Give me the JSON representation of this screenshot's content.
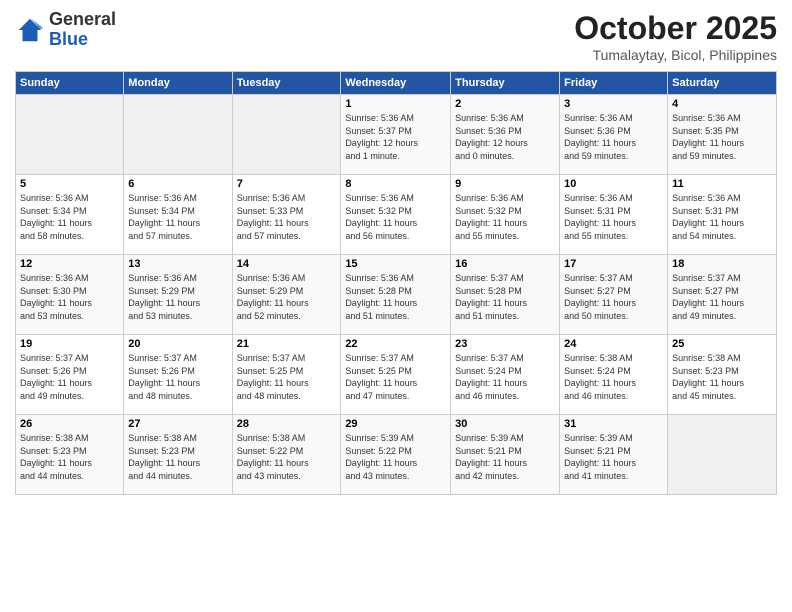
{
  "header": {
    "logo_general": "General",
    "logo_blue": "Blue",
    "month_title": "October 2025",
    "subtitle": "Tumalaytay, Bicol, Philippines"
  },
  "days_of_week": [
    "Sunday",
    "Monday",
    "Tuesday",
    "Wednesday",
    "Thursday",
    "Friday",
    "Saturday"
  ],
  "weeks": [
    [
      {
        "day": "",
        "info": ""
      },
      {
        "day": "",
        "info": ""
      },
      {
        "day": "",
        "info": ""
      },
      {
        "day": "1",
        "info": "Sunrise: 5:36 AM\nSunset: 5:37 PM\nDaylight: 12 hours\nand 1 minute."
      },
      {
        "day": "2",
        "info": "Sunrise: 5:36 AM\nSunset: 5:36 PM\nDaylight: 12 hours\nand 0 minutes."
      },
      {
        "day": "3",
        "info": "Sunrise: 5:36 AM\nSunset: 5:36 PM\nDaylight: 11 hours\nand 59 minutes."
      },
      {
        "day": "4",
        "info": "Sunrise: 5:36 AM\nSunset: 5:35 PM\nDaylight: 11 hours\nand 59 minutes."
      }
    ],
    [
      {
        "day": "5",
        "info": "Sunrise: 5:36 AM\nSunset: 5:34 PM\nDaylight: 11 hours\nand 58 minutes."
      },
      {
        "day": "6",
        "info": "Sunrise: 5:36 AM\nSunset: 5:34 PM\nDaylight: 11 hours\nand 57 minutes."
      },
      {
        "day": "7",
        "info": "Sunrise: 5:36 AM\nSunset: 5:33 PM\nDaylight: 11 hours\nand 57 minutes."
      },
      {
        "day": "8",
        "info": "Sunrise: 5:36 AM\nSunset: 5:32 PM\nDaylight: 11 hours\nand 56 minutes."
      },
      {
        "day": "9",
        "info": "Sunrise: 5:36 AM\nSunset: 5:32 PM\nDaylight: 11 hours\nand 55 minutes."
      },
      {
        "day": "10",
        "info": "Sunrise: 5:36 AM\nSunset: 5:31 PM\nDaylight: 11 hours\nand 55 minutes."
      },
      {
        "day": "11",
        "info": "Sunrise: 5:36 AM\nSunset: 5:31 PM\nDaylight: 11 hours\nand 54 minutes."
      }
    ],
    [
      {
        "day": "12",
        "info": "Sunrise: 5:36 AM\nSunset: 5:30 PM\nDaylight: 11 hours\nand 53 minutes."
      },
      {
        "day": "13",
        "info": "Sunrise: 5:36 AM\nSunset: 5:29 PM\nDaylight: 11 hours\nand 53 minutes."
      },
      {
        "day": "14",
        "info": "Sunrise: 5:36 AM\nSunset: 5:29 PM\nDaylight: 11 hours\nand 52 minutes."
      },
      {
        "day": "15",
        "info": "Sunrise: 5:36 AM\nSunset: 5:28 PM\nDaylight: 11 hours\nand 51 minutes."
      },
      {
        "day": "16",
        "info": "Sunrise: 5:37 AM\nSunset: 5:28 PM\nDaylight: 11 hours\nand 51 minutes."
      },
      {
        "day": "17",
        "info": "Sunrise: 5:37 AM\nSunset: 5:27 PM\nDaylight: 11 hours\nand 50 minutes."
      },
      {
        "day": "18",
        "info": "Sunrise: 5:37 AM\nSunset: 5:27 PM\nDaylight: 11 hours\nand 49 minutes."
      }
    ],
    [
      {
        "day": "19",
        "info": "Sunrise: 5:37 AM\nSunset: 5:26 PM\nDaylight: 11 hours\nand 49 minutes."
      },
      {
        "day": "20",
        "info": "Sunrise: 5:37 AM\nSunset: 5:26 PM\nDaylight: 11 hours\nand 48 minutes."
      },
      {
        "day": "21",
        "info": "Sunrise: 5:37 AM\nSunset: 5:25 PM\nDaylight: 11 hours\nand 48 minutes."
      },
      {
        "day": "22",
        "info": "Sunrise: 5:37 AM\nSunset: 5:25 PM\nDaylight: 11 hours\nand 47 minutes."
      },
      {
        "day": "23",
        "info": "Sunrise: 5:37 AM\nSunset: 5:24 PM\nDaylight: 11 hours\nand 46 minutes."
      },
      {
        "day": "24",
        "info": "Sunrise: 5:38 AM\nSunset: 5:24 PM\nDaylight: 11 hours\nand 46 minutes."
      },
      {
        "day": "25",
        "info": "Sunrise: 5:38 AM\nSunset: 5:23 PM\nDaylight: 11 hours\nand 45 minutes."
      }
    ],
    [
      {
        "day": "26",
        "info": "Sunrise: 5:38 AM\nSunset: 5:23 PM\nDaylight: 11 hours\nand 44 minutes."
      },
      {
        "day": "27",
        "info": "Sunrise: 5:38 AM\nSunset: 5:23 PM\nDaylight: 11 hours\nand 44 minutes."
      },
      {
        "day": "28",
        "info": "Sunrise: 5:38 AM\nSunset: 5:22 PM\nDaylight: 11 hours\nand 43 minutes."
      },
      {
        "day": "29",
        "info": "Sunrise: 5:39 AM\nSunset: 5:22 PM\nDaylight: 11 hours\nand 43 minutes."
      },
      {
        "day": "30",
        "info": "Sunrise: 5:39 AM\nSunset: 5:21 PM\nDaylight: 11 hours\nand 42 minutes."
      },
      {
        "day": "31",
        "info": "Sunrise: 5:39 AM\nSunset: 5:21 PM\nDaylight: 11 hours\nand 41 minutes."
      },
      {
        "day": "",
        "info": ""
      }
    ]
  ]
}
